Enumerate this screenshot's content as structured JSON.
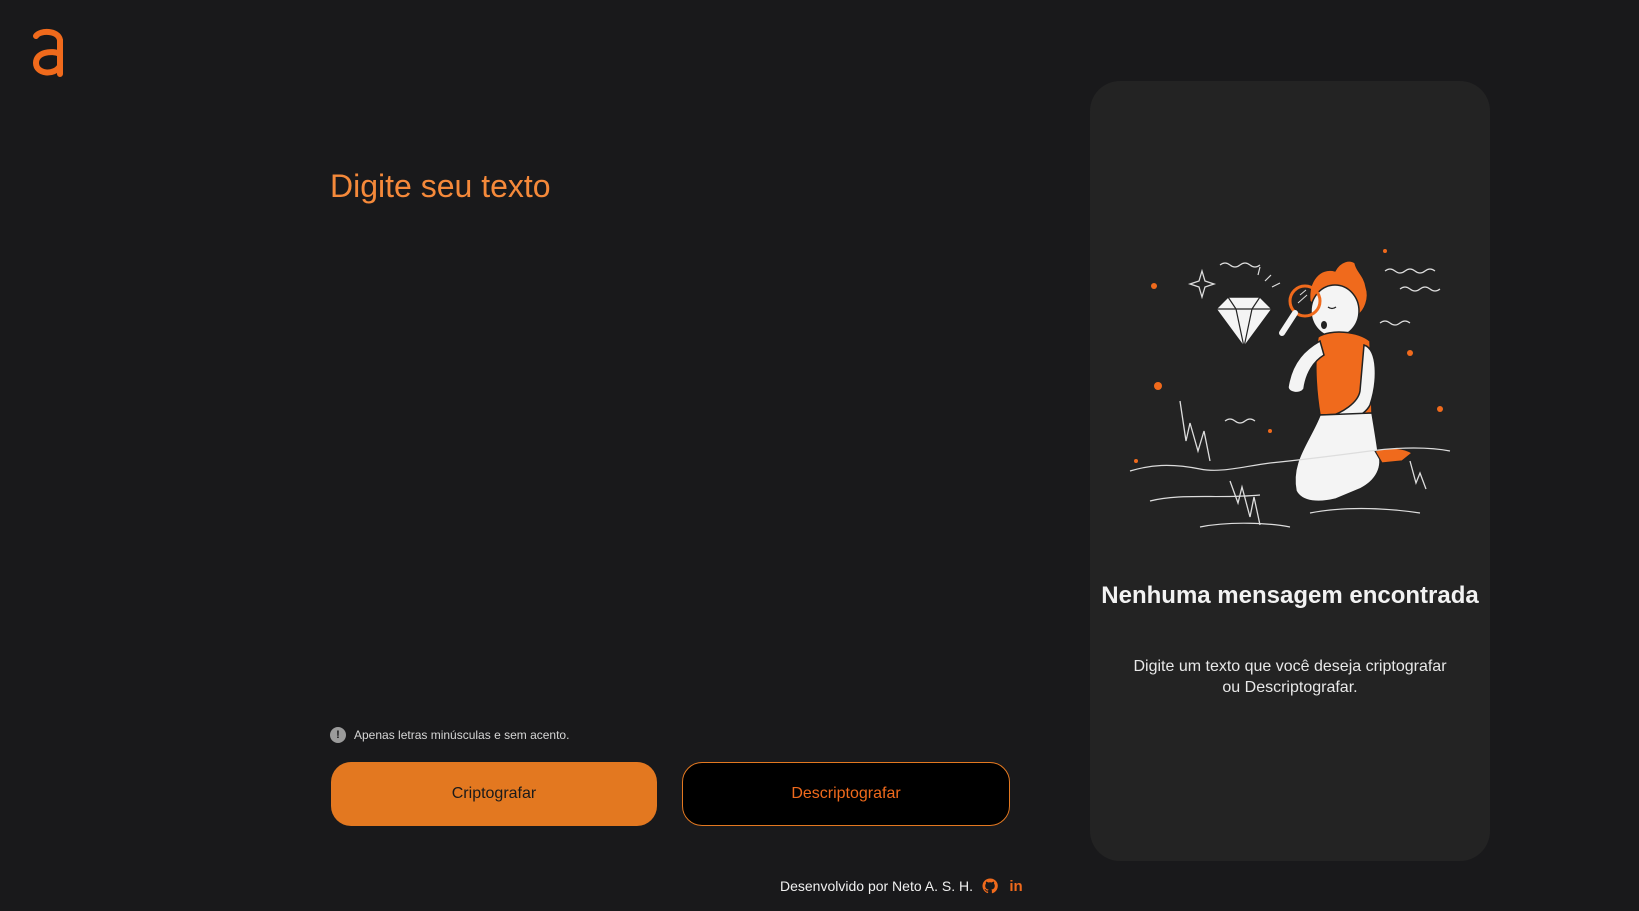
{
  "app": {
    "logo": "a"
  },
  "input": {
    "placeholder": "Digite seu texto",
    "value": ""
  },
  "hint": {
    "icon": "exclamation-icon",
    "text": "Apenas letras minúsculas e sem acento."
  },
  "buttons": {
    "encrypt_label": "Criptografar",
    "decrypt_label": "Descriptografar"
  },
  "output_panel": {
    "title": "Nenhuma mensagem encontrada",
    "description": "Digite um texto que você deseja criptografar ou Descriptografar."
  },
  "footer": {
    "credit": "Desenvolvido por Neto A. S. H.",
    "github_icon": "github-icon",
    "linkedin_icon": "linkedin-icon",
    "linkedin_text": "in"
  },
  "colors": {
    "background": "#19191b",
    "accent": "#e37820",
    "accent_text": "#f5893a",
    "panel": "#232323"
  }
}
